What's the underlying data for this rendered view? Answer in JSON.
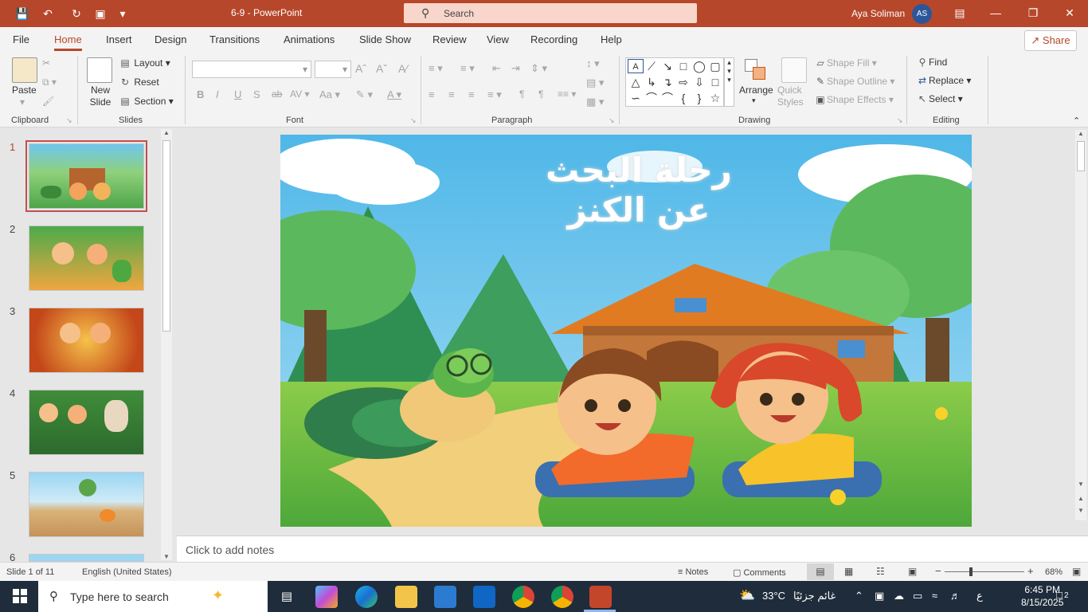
{
  "window": {
    "doc_title": "6-9  -  PowerPoint",
    "search_placeholder": "Search",
    "user_name": "Aya Soliman",
    "user_initials": "AS"
  },
  "tabs": [
    "File",
    "Home",
    "Insert",
    "Design",
    "Transitions",
    "Animations",
    "Slide Show",
    "Review",
    "View",
    "Recording",
    "Help"
  ],
  "active_tab": "Home",
  "share_label": "Share",
  "ribbon": {
    "clipboard": {
      "label": "Clipboard",
      "paste": "Paste"
    },
    "slides": {
      "label": "Slides",
      "new_slide": "New Slide",
      "layout": "Layout",
      "reset": "Reset",
      "section": "Section"
    },
    "font": {
      "label": "Font"
    },
    "paragraph": {
      "label": "Paragraph"
    },
    "drawing": {
      "label": "Drawing",
      "arrange": "Arrange",
      "quick_styles": "Quick Styles",
      "shape_fill": "Shape Fill",
      "shape_outline": "Shape Outline",
      "shape_effects": "Shape Effects"
    },
    "editing": {
      "label": "Editing",
      "find": "Find",
      "replace": "Replace",
      "select": "Select"
    }
  },
  "thumbnails": [
    "1",
    "2",
    "3",
    "4",
    "5",
    "6"
  ],
  "current_slide": 1,
  "slide": {
    "title_line1": "رحلة البحث",
    "title_line2": "عن الكنز"
  },
  "notes_placeholder": "Click to add notes",
  "status": {
    "slide_info": "Slide 1 of 11",
    "language": "English (United States)",
    "notes": "Notes",
    "comments": "Comments",
    "zoom": "68%"
  },
  "taskbar": {
    "search_placeholder": "Type here to search",
    "weather_temp": "33°C",
    "weather_text": "غائم جزئيًا",
    "lang": "ع",
    "time": "6:45 PM",
    "date": "8/15/2025",
    "notif_count": "2"
  },
  "colors": {
    "accent": "#b7472a",
    "taskbar": "#1f2c3b"
  }
}
